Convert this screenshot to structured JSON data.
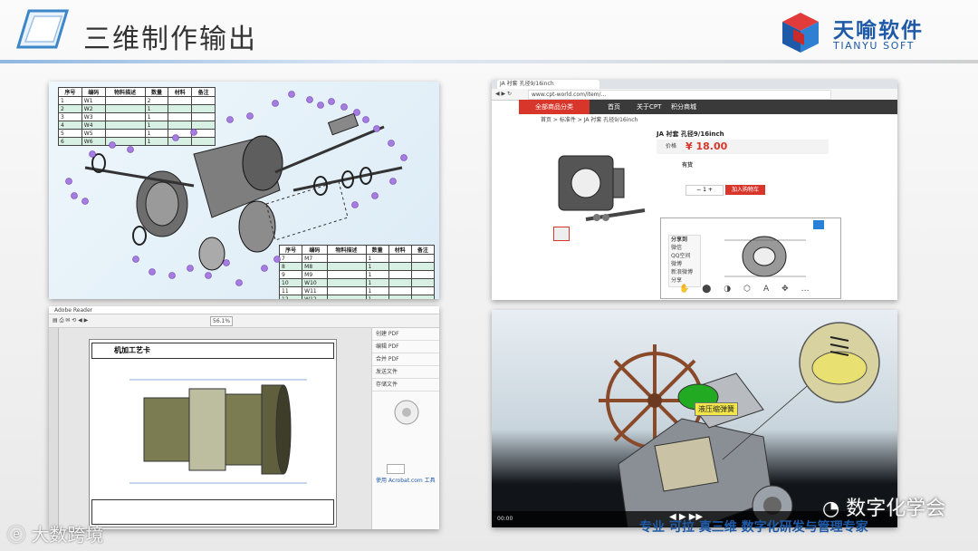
{
  "header": {
    "title": "三维制作输出"
  },
  "logo": {
    "cn": "天喻软件",
    "en": "TIANYU SOFT"
  },
  "exploded": {
    "table_top": {
      "headers": [
        "序号",
        "编码",
        "物料描述",
        "数量",
        "材料",
        "备注"
      ],
      "rows": [
        [
          "1",
          "W1",
          "",
          "2",
          "",
          ""
        ],
        [
          "2",
          "W2",
          "",
          "1",
          "",
          ""
        ],
        [
          "3",
          "W3",
          "",
          "1",
          "",
          ""
        ],
        [
          "4",
          "W4",
          "",
          "1",
          "",
          ""
        ],
        [
          "5",
          "W5",
          "",
          "1",
          "",
          ""
        ],
        [
          "6",
          "W6",
          "",
          "1",
          "",
          ""
        ]
      ]
    },
    "table_bottom": {
      "headers": [
        "序号",
        "编码",
        "物料描述",
        "数量",
        "材料",
        "备注"
      ],
      "rows": [
        [
          "7",
          "M7",
          "",
          "1",
          "",
          ""
        ],
        [
          "8",
          "M8",
          "",
          "1",
          "",
          ""
        ],
        [
          "9",
          "M9",
          "",
          "1",
          "",
          ""
        ],
        [
          "10",
          "W10",
          "",
          "1",
          "",
          ""
        ],
        [
          "11",
          "W11",
          "",
          "1",
          "",
          ""
        ],
        [
          "12",
          "W12",
          "",
          "1",
          "",
          ""
        ]
      ]
    }
  },
  "web": {
    "tab": "JA 衬套 孔径9/16inch",
    "url": "www.cpt-world.com/item/...",
    "nav": [
      "全部商品分类",
      "首页",
      "关于CPT",
      "积分商城"
    ],
    "breadcrumb": "首页 > 标准件 > JA 衬套 孔径9/16inch",
    "product_title": "JA 衬套 孔径9/16inch",
    "price_label": "价格",
    "price": "¥ 18.00",
    "stock_label": "有货",
    "cart_button": "加入购物车",
    "sidebar_title": "分享到",
    "share_items": [
      "微信",
      "QQ空间",
      "微博",
      "新浪微博",
      "分享"
    ]
  },
  "pdf": {
    "window_title": "Adobe Reader",
    "zoom": "56.1%",
    "doc_heading": "机加工艺卡",
    "right_panel": [
      "创建 PDF",
      "编辑 PDF",
      "合并 PDF",
      "发送文件",
      "存储文件"
    ],
    "right_footer": "使用 Acrobat.com 工具"
  },
  "video": {
    "label": "液压缩弹簧",
    "time_left": "00:00",
    "time_right": "04:00"
  },
  "watermarks": {
    "bottom_left": "大数跨境",
    "bottom_right": "数字化学会",
    "tagline": "专业 可拉 真三维 数字化研发与管理专家"
  },
  "colors": {
    "accent": "#1e5aa8",
    "table_alt": "#d8f0e4",
    "part_dot": "#a67ce0"
  }
}
